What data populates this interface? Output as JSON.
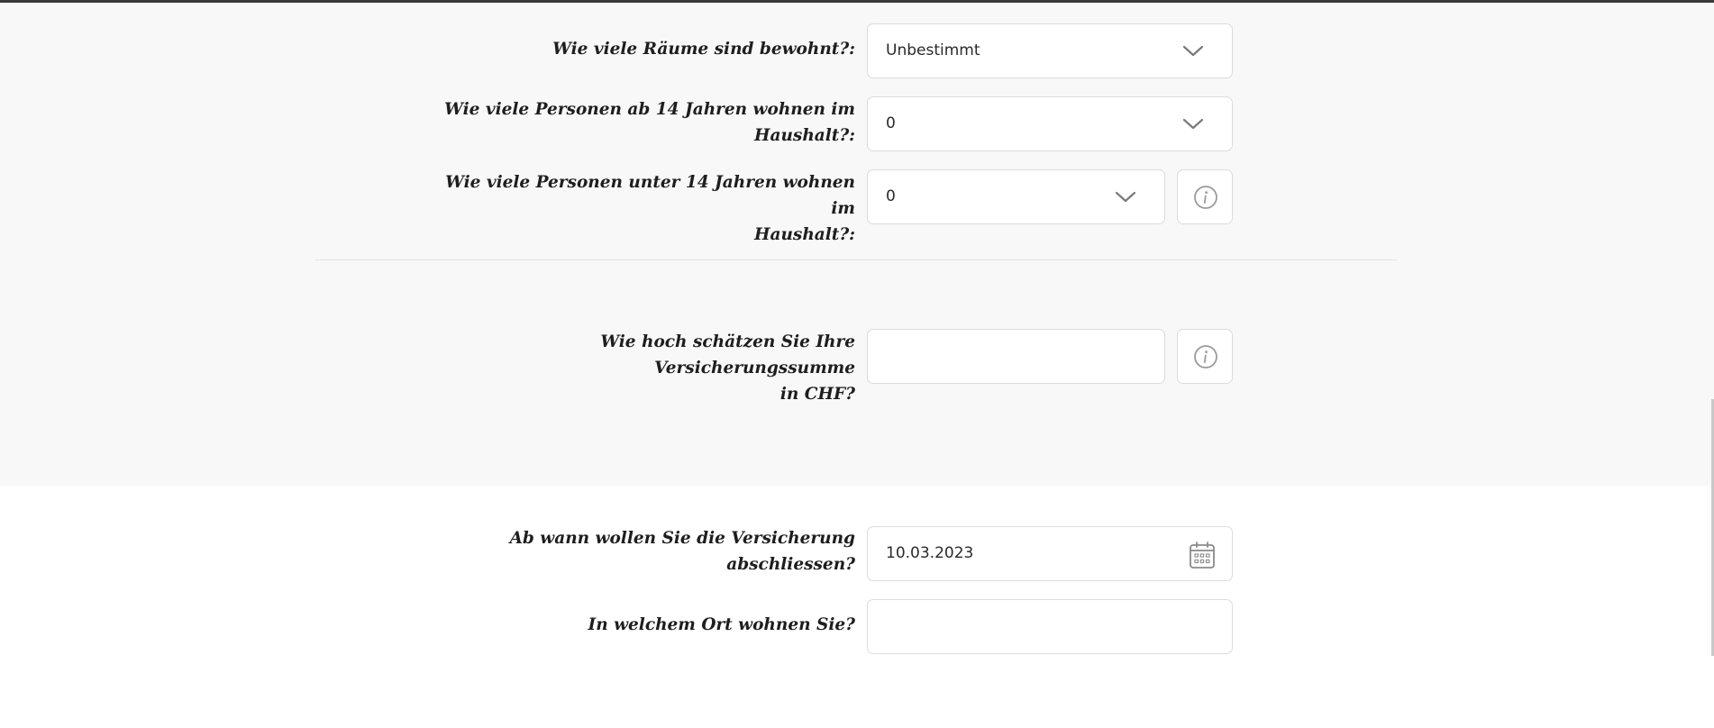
{
  "rooms": {
    "label": "Wie viele Räume sind bewohnt?:",
    "value": "Unbestimmt"
  },
  "persons_over_14": {
    "label_line1": "Wie viele Personen ab 14 Jahren wohnen im",
    "label_line2": "Haushalt?:",
    "value": "0"
  },
  "persons_under_14": {
    "label_line1": "Wie viele Personen unter 14 Jahren wohnen im",
    "label_line2": "Haushalt?:",
    "value": "0"
  },
  "insurance_sum": {
    "label_line1": "Wie hoch schätzen Sie Ihre Versicherungssumme",
    "label_line2": "in CHF?",
    "value": ""
  },
  "start_date": {
    "label_line1": "Ab wann wollen Sie die Versicherung",
    "label_line2": "abschliessen?",
    "value": "10.03.2023"
  },
  "location": {
    "label": "In welchem Ort wohnen Sie?",
    "value": ""
  },
  "icons": {
    "dropdown": "chevron-down-icon",
    "info": "info-icon",
    "calendar": "calendar-icon"
  },
  "colors": {
    "panel_grey": "#f8f8f8",
    "border": "#dcdcdc",
    "icon_grey": "#9a9a9a"
  }
}
